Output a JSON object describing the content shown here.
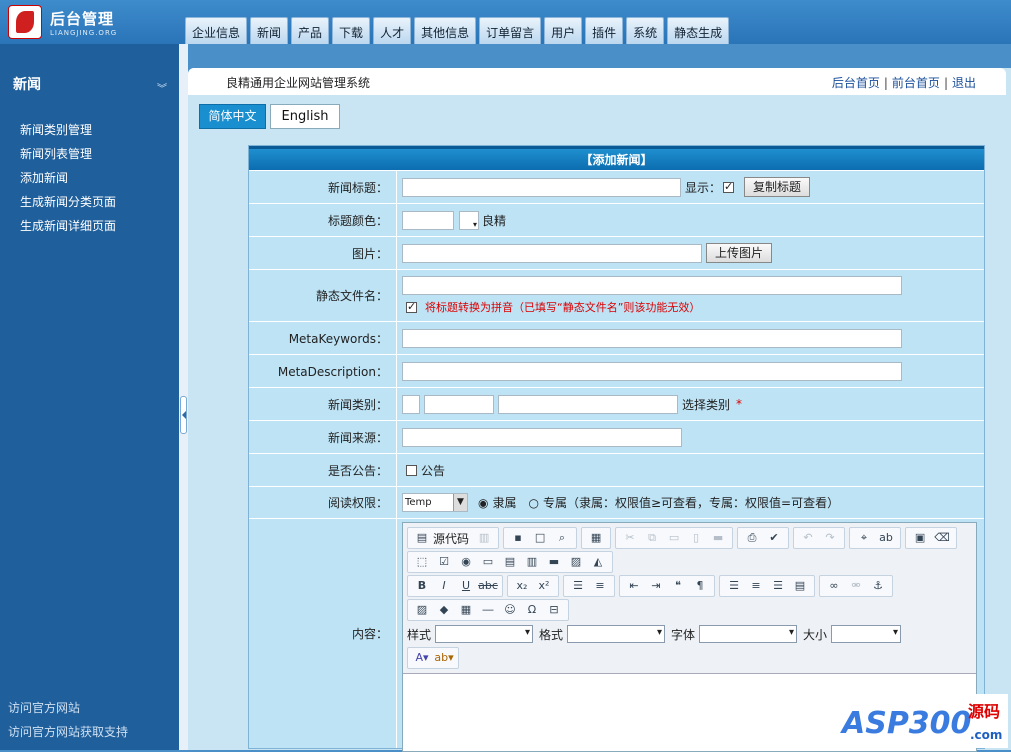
{
  "header": {
    "logo_title": "后台管理",
    "logo_sub": "LIANGJING.ORG",
    "nav": [
      "企业信息",
      "新闻",
      "产品",
      "下载",
      "人才",
      "其他信息",
      "订单留言",
      "用户",
      "插件",
      "系统",
      "静态生成"
    ]
  },
  "sidebar": {
    "title": "新闻",
    "items": [
      "新闻类别管理",
      "新闻列表管理",
      "添加新闻",
      "生成新闻分类页面",
      "生成新闻详细页面"
    ],
    "footer": [
      "访问官方网站",
      "访问官方网站获取支持"
    ]
  },
  "topbar": {
    "system_name": "良精通用企业网站管理系统",
    "links": [
      "后台首页",
      "前台首页",
      "退出"
    ]
  },
  "languages": {
    "cn": "简体中文",
    "en": "English"
  },
  "form": {
    "title": "【添加新闻】",
    "title_label": "新闻标题：",
    "show_label": "显示：",
    "copy_title_button": "复制标题",
    "color_label": "标题颜色：",
    "color_caption": "良精",
    "image_label": "图片：",
    "upload_button": "上传图片",
    "static_label": "静态文件名：",
    "pinyin_note": "将标题转换为拼音（已填写“静态文件名”则该功能无效）",
    "keywords_label": "MetaKeywords：",
    "description_label": "MetaDescription：",
    "category_label": "新闻类别：",
    "choose_category": "选择类别",
    "required_mark": "*",
    "source_label": "新闻来源：",
    "notice_label": "是否公告：",
    "notice_option": "公告",
    "permission_label": "阅读权限：",
    "permission_select": "Temp",
    "permission_opt1": "隶属",
    "permission_opt2": "专属（隶属：权限值≥可查看，专属：权限值=可查看）",
    "content_label": "内容："
  },
  "editor": {
    "source_button": "源代码",
    "style_label": "样式",
    "format_label": "格式",
    "font_label": "字体",
    "size_label": "大小"
  },
  "watermark": {
    "main": "ASP300",
    "right": "源码",
    "domain": ".com"
  }
}
